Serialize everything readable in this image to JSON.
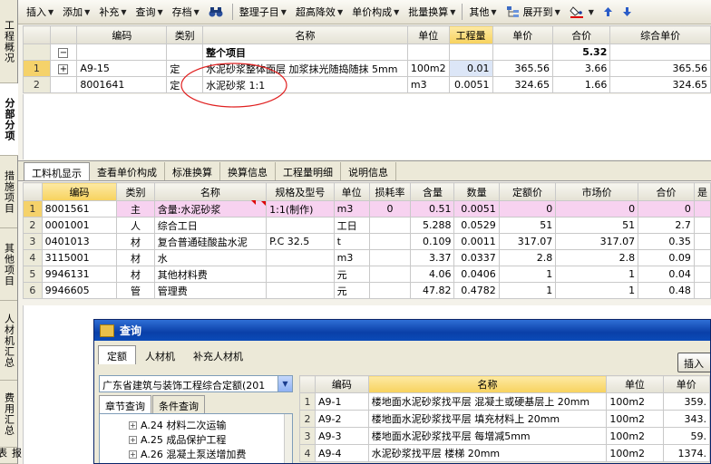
{
  "left_tabs": [
    "工程概况",
    "分部分项",
    "措施项目",
    "其他项目",
    "人材机汇总",
    "费用汇总",
    "报表"
  ],
  "toolbar": {
    "items": [
      "插入",
      "添加",
      "补充",
      "查询",
      "存档",
      "整理子目",
      "超高降效",
      "单价构成",
      "批量换算",
      "其他",
      "展开到"
    ]
  },
  "top_grid": {
    "headers": [
      "编码",
      "类别",
      "名称",
      "单位",
      "工程量",
      "单价",
      "合价",
      "综合单价"
    ],
    "group_row": {
      "toggle": "−",
      "name": "整个项目",
      "total": "5.32"
    },
    "rows": [
      {
        "rn": "1",
        "code": "A9-15",
        "type": "定",
        "name": "水泥砂浆整体面层 加浆抹光随捣随抹 5mm",
        "unit": "100m2",
        "qty": "0.01",
        "price": "365.56",
        "total": "3.66",
        "comp": "365.56"
      },
      {
        "rn": "2",
        "code": "8001641",
        "type": "定",
        "name": "水泥砂浆 1:1",
        "unit": "m3",
        "qty": "0.0051",
        "price": "324.65",
        "total": "1.66",
        "comp": "324.65"
      }
    ]
  },
  "mid_tabs": [
    "工料机显示",
    "查看单价构成",
    "标准换算",
    "换算信息",
    "工程量明细",
    "说明信息"
  ],
  "bottom_grid": {
    "headers": [
      "编码",
      "类别",
      "名称",
      "规格及型号",
      "单位",
      "损耗率",
      "含量",
      "数量",
      "定额价",
      "市场价",
      "合价",
      "是"
    ],
    "rows": [
      {
        "rn": "1",
        "code": "8001561",
        "type": "主",
        "name": "含量:水泥砂浆",
        "spec": "1:1(制作)",
        "unit": "m3",
        "loss": "0",
        "content": "0.51",
        "qty": "0.0051",
        "base": "0",
        "market": "0",
        "total": "0"
      },
      {
        "rn": "2",
        "code": "0001001",
        "type": "人",
        "name": "综合工日",
        "spec": "",
        "unit": "工日",
        "loss": "",
        "content": "5.288",
        "qty": "0.0529",
        "base": "51",
        "market": "51",
        "total": "2.7"
      },
      {
        "rn": "3",
        "code": "0401013",
        "type": "材",
        "name": "复合普通硅酸盐水泥",
        "spec": "P.C 32.5",
        "unit": "t",
        "loss": "",
        "content": "0.109",
        "qty": "0.0011",
        "base": "317.07",
        "market": "317.07",
        "total": "0.35"
      },
      {
        "rn": "4",
        "code": "3115001",
        "type": "材",
        "name": "水",
        "spec": "",
        "unit": "m3",
        "loss": "",
        "content": "3.37",
        "qty": "0.0337",
        "base": "2.8",
        "market": "2.8",
        "total": "0.09"
      },
      {
        "rn": "5",
        "code": "9946131",
        "type": "材",
        "name": "其他材料费",
        "spec": "",
        "unit": "元",
        "loss": "",
        "content": "4.06",
        "qty": "0.0406",
        "base": "1",
        "market": "1",
        "total": "0.04"
      },
      {
        "rn": "6",
        "code": "9946605",
        "type": "管",
        "name": "管理费",
        "spec": "",
        "unit": "元",
        "loss": "",
        "content": "47.82",
        "qty": "0.4782",
        "base": "1",
        "market": "1",
        "total": "0.48"
      }
    ]
  },
  "dialog": {
    "title": "查询",
    "tabs": [
      "定额",
      "人材机",
      "补充人材机"
    ],
    "insert_label": "插入",
    "region": "广东省建筑与装饰工程综合定额(201",
    "sub_tabs": [
      "章节查询",
      "条件查询"
    ],
    "tree": [
      "A.24 材料二次运输",
      "A.25 成品保护工程",
      "A.26 混凝土泵送增加费"
    ],
    "grid": {
      "headers": [
        "编码",
        "名称",
        "单位",
        "单价"
      ],
      "rows": [
        {
          "rn": "1",
          "code": "A9-1",
          "name": "楼地面水泥砂浆找平层 混凝土或硬基层上 20mm",
          "unit": "100m2",
          "price": "359."
        },
        {
          "rn": "2",
          "code": "A9-2",
          "name": "楼地面水泥砂浆找平层 填充材料上 20mm",
          "unit": "100m2",
          "price": "343."
        },
        {
          "rn": "3",
          "code": "A9-3",
          "name": "楼地面水泥砂浆找平层 每增减5mm",
          "unit": "100m2",
          "price": "59."
        },
        {
          "rn": "4",
          "code": "A9-4",
          "name": "水泥砂浆找平层 楼梯 20mm",
          "unit": "100m2",
          "price": "1374."
        }
      ]
    }
  },
  "colors": {
    "selected_row": "#f7d2f0",
    "header_highlight": "#f7d25d",
    "annotation": "#e02020",
    "dialog_title": "#0a3fa8"
  }
}
